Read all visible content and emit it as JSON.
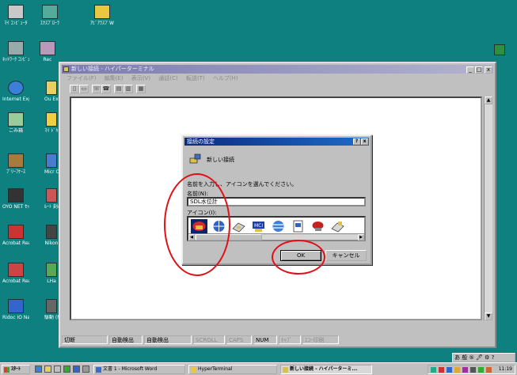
{
  "desktop": {
    "icons": [
      {
        "label": "ﾏｲ ｺﾝﾋﾟｭｰﾀ",
        "name": "my-computer-icon"
      },
      {
        "label": "ｴｸｽﾌﾟﾛｰﾗ",
        "name": "explorer-icon"
      },
      {
        "label": "ｱﾋﾟｱﾗｽﾌﾟW",
        "name": "word-app-icon"
      },
      {
        "label": "ﾈｯﾄﾜｰｸ ｺﾝﾋﾟｭｰﾀ",
        "name": "network-computer-icon"
      },
      {
        "label": "Rec",
        "name": "recorder-icon"
      },
      {
        "label": "Internet Explorer",
        "name": "internet-explorer-icon"
      },
      {
        "label": "Ou Exp",
        "name": "outlook-express-icon"
      },
      {
        "label": "ごみ箱",
        "name": "recycle-bin-icon"
      },
      {
        "label": "ﾏｲ ﾄﾞｷ",
        "name": "my-documents-icon"
      },
      {
        "label": "ﾌﾞﾘｰﾌｹｰｽ",
        "name": "briefcase-icon"
      },
      {
        "label": "Micr Out",
        "name": "microsoft-outlook-icon"
      },
      {
        "label": "OYO NET ｾｯﾄｱｯﾌﾟ",
        "name": "oyo-net-setup-icon"
      },
      {
        "label": "ﾙｰﾄ 刻み",
        "name": "route-icon"
      },
      {
        "label": "Acrobat Reader 5.0",
        "name": "acrobat-reader-5-icon"
      },
      {
        "label": "Nikon",
        "name": "nikon-icon"
      },
      {
        "label": "Acrobat Reader 4.0",
        "name": "acrobat-reader-4-icon"
      },
      {
        "label": "LHa",
        "name": "lha-icon"
      },
      {
        "label": "Ridoc IO Navi",
        "name": "ridoc-io-navi-icon"
      },
      {
        "label": "駆動 (Net",
        "name": "net-drive-icon"
      },
      {
        "label": "",
        "name": "excel-shortcut-icon"
      }
    ]
  },
  "window": {
    "title": "新しい接続 - ハイパーターミナル",
    "menu": [
      "ファイル(F)",
      "編集(E)",
      "表示(V)",
      "通話(C)",
      "転送(T)",
      "ヘルプ(H)"
    ],
    "minimize": "_",
    "maximize": "□",
    "close": "x",
    "status": [
      "切断",
      "自動検出",
      "自動検出",
      "SCROLL",
      "CAPS",
      "NUM",
      "ｷｬﾌﾟ",
      "ｴｺｰ印刷"
    ]
  },
  "dialog": {
    "title": "接続の設定",
    "help": "?",
    "close": "x",
    "connection_name": "新しい接続",
    "prompt": "名前を入力し、アイコンを選んでください。",
    "name_label": "名前(N):",
    "name_value": "SDL水位計",
    "icon_label": "アイコン(I):",
    "icons": [
      "red-phone-icon",
      "globe-icon",
      "modem-icon",
      "mci-icon",
      "att-globe-icon",
      "document-icon",
      "red-telephone-icon",
      "fax-modem-icon"
    ],
    "selected_icon": 0,
    "ok_label": "OK",
    "cancel_label": "キャンセル"
  },
  "taskbar": {
    "start": "ｽﾀｰﾄ",
    "tasks": [
      {
        "label": "文書 1 - Microsoft Word",
        "active": false
      },
      {
        "label": "HyperTerminal",
        "active": false
      },
      {
        "label": "新しい接続 - ハイパーターミ...",
        "active": true
      }
    ],
    "clock": "11:19"
  },
  "ime": {
    "text": "あ 般 ⑤ 🖊 ⚙ ?"
  },
  "colors": {
    "desktop": "#0f8080",
    "annotation": "#e01018",
    "selection": "#0a246a"
  }
}
